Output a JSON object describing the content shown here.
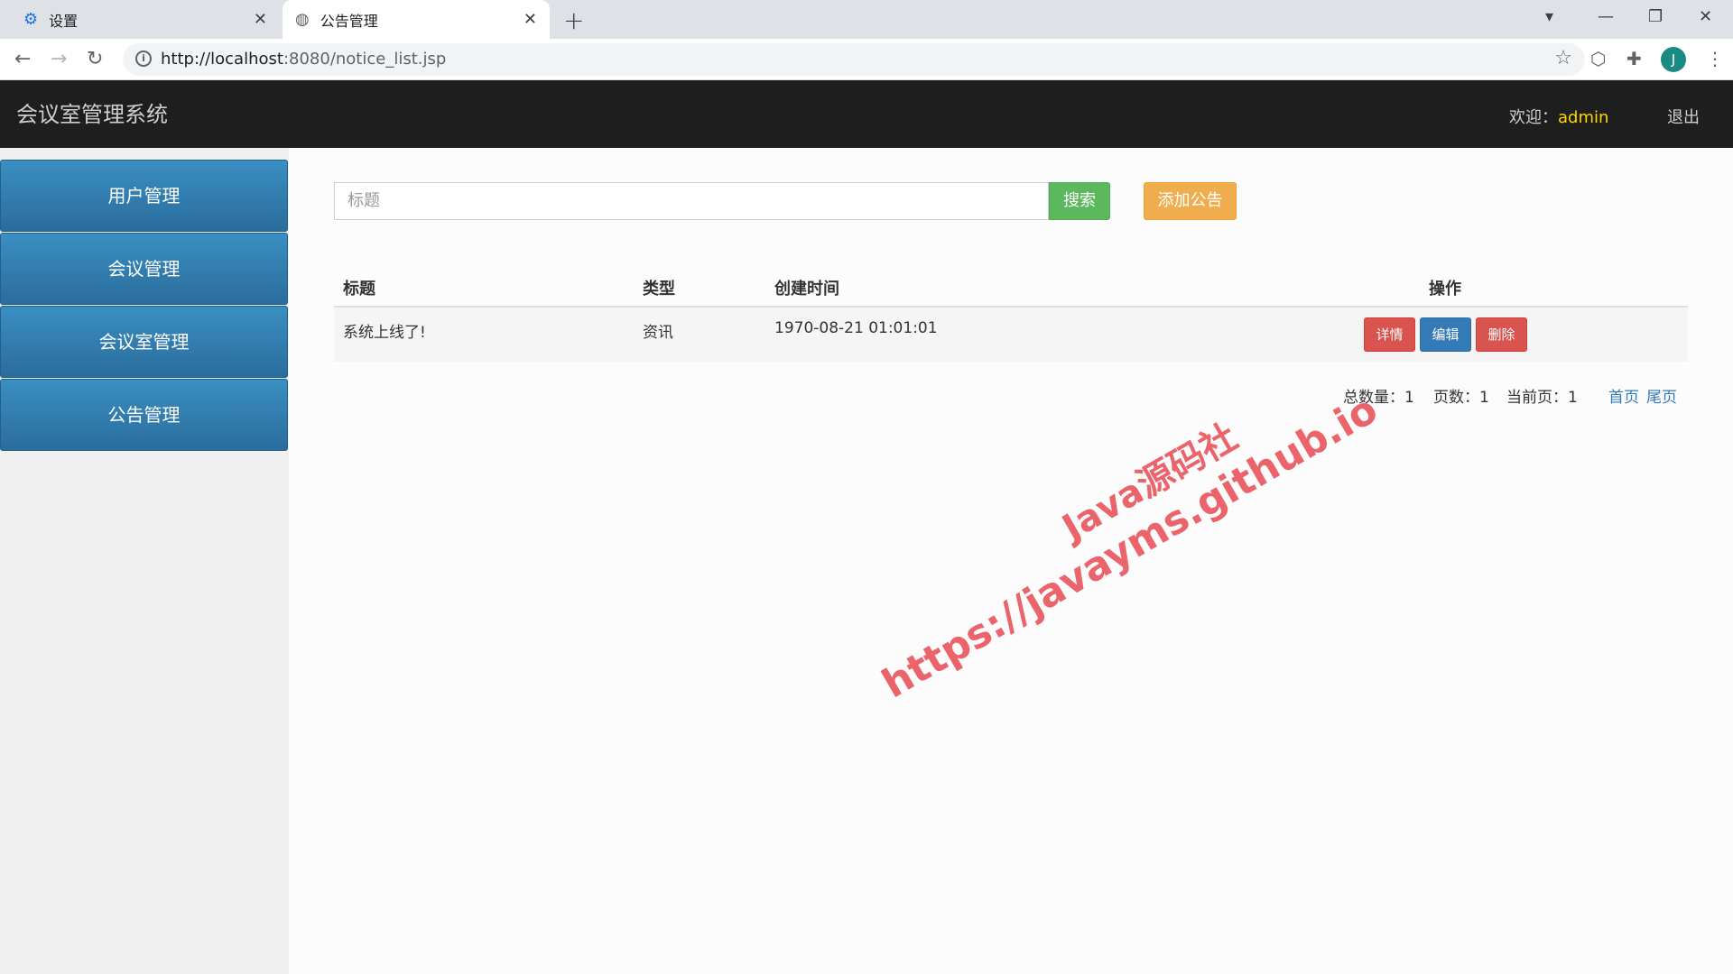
{
  "browser": {
    "tabs": [
      {
        "label": "设置"
      },
      {
        "label": "公告管理"
      }
    ],
    "url_host": "http://localhost",
    "url_rest": ":8080/notice_list.jsp",
    "avatar_letter": "J"
  },
  "header": {
    "title": "会议室管理系统",
    "welcome_label": "欢迎：",
    "username": "admin",
    "logout_label": "退出"
  },
  "sidebar": {
    "items": [
      {
        "label": "用户管理"
      },
      {
        "label": "会议管理"
      },
      {
        "label": "会议室管理"
      },
      {
        "label": "公告管理"
      }
    ]
  },
  "toolbar": {
    "search_placeholder": "标题",
    "search_label": "搜索",
    "add_label": "添加公告"
  },
  "table": {
    "headers": [
      "标题",
      "类型",
      "创建时间",
      "操作"
    ],
    "rows": [
      {
        "title": "系统上线了!",
        "type": "资讯",
        "created": "1970-08-21 01:01:01"
      }
    ],
    "actions": {
      "detail": "详情",
      "edit": "编辑",
      "delete": "删除"
    }
  },
  "pager": {
    "total": "总数量：1",
    "pages": "页数：1",
    "current": "当前页：1",
    "first": "首页",
    "last": "尾页"
  },
  "watermark": {
    "line1": "Java源码社",
    "line2": "https://javayms.github.io"
  }
}
